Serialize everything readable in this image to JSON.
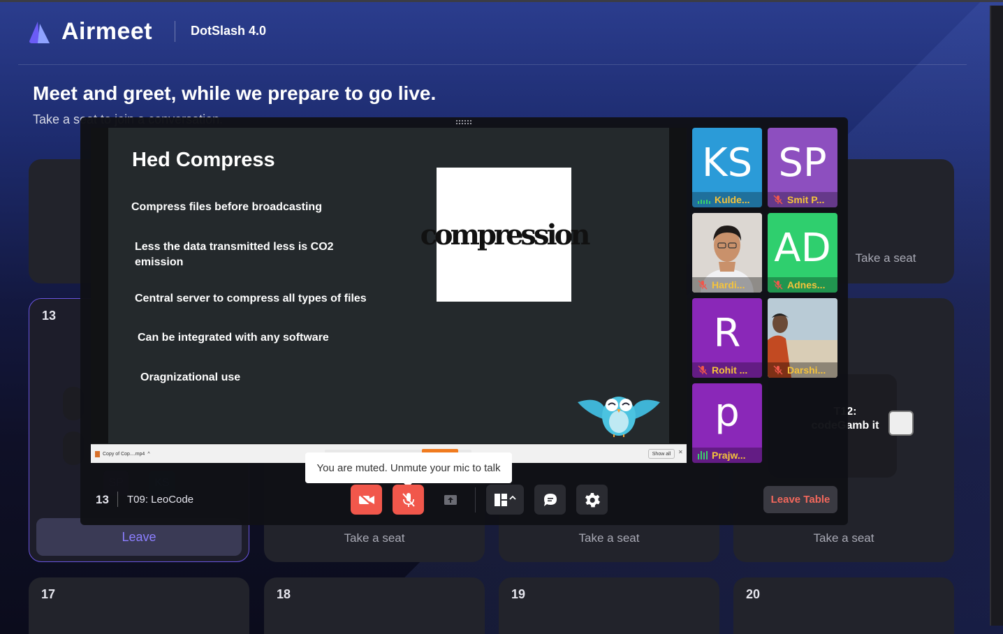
{
  "app": {
    "brand": "Airmeet",
    "event_name": "DotSlash 4.0",
    "headline": "Meet and greet, while we prepare to go live.",
    "subline": "Take a seat to join a conversation."
  },
  "tables": [
    {
      "number": "",
      "seat_label": "Take a seat"
    },
    {
      "number": "13",
      "action_label": "Leave"
    },
    {
      "number": "",
      "seat_label": "Take a seat"
    },
    {
      "number": "",
      "seat_label": "Take a seat"
    },
    {
      "number": "",
      "seat_label": "Take a seat"
    },
    {
      "number": "17"
    },
    {
      "number": "18"
    },
    {
      "number": "19"
    },
    {
      "number": "20"
    }
  ],
  "side_table": {
    "label": "T12: codeGamb it"
  },
  "slide": {
    "title": "Hed Compress",
    "bullets": [
      "Compress files before broadcasting",
      "Less the data transmitted less is CO2 emission",
      "Central server to compress all types of files",
      "Can be integrated with any software",
      "Oragnizational use"
    ],
    "image_word": "compression"
  },
  "download_bar": {
    "file": "Copy of Cop....mp4",
    "show_all": "Show all",
    "close": "✕"
  },
  "participants": [
    {
      "initials": "KS",
      "name": "Kulde...",
      "bg": "#2b9bd8",
      "audio": "speaking"
    },
    {
      "initials": "SP",
      "name": "Smit P...",
      "bg": "#8d4fbf",
      "audio": "muted"
    },
    {
      "initials": "",
      "name": "Hardi...",
      "bg": "#d9d4cf",
      "audio": "muted",
      "photo": true
    },
    {
      "initials": "AD",
      "name": "Adnes...",
      "bg": "#2fcf6e",
      "audio": "muted"
    },
    {
      "initials": "R",
      "name": "Rohit ...",
      "bg": "#8a28b8",
      "audio": "muted"
    },
    {
      "initials": "",
      "name": "Darshi...",
      "bg": "#b9a98e",
      "audio": "muted",
      "photo": true
    },
    {
      "initials": "p",
      "name": "Prajw...",
      "bg": "#8a28b8",
      "audio": "speaking"
    }
  ],
  "controls": {
    "table_number": "13",
    "table_name": "T09: LeoCode",
    "muted_tooltip": "You are muted. Unmute your mic to talk",
    "leave_table": "Leave Table",
    "icons": [
      "camera-off-icon",
      "mic-off-icon",
      "share-screen-icon",
      "layout-icon",
      "chat-icon",
      "settings-icon"
    ]
  },
  "colors": {
    "accent": "#6a55e0",
    "danger": "#f1574b",
    "name_yellow": "#f5c33b"
  }
}
